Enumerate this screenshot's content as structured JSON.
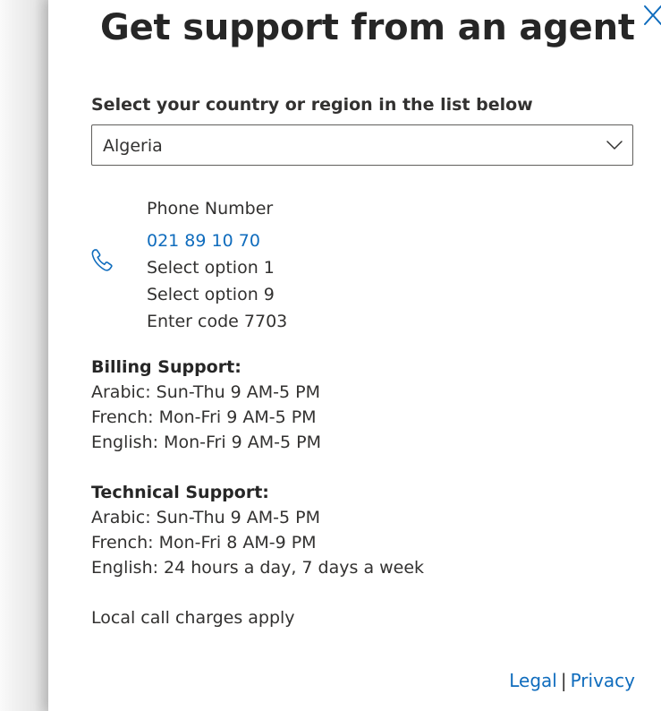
{
  "dialog": {
    "title": "Get support from an agent",
    "close_icon": "close-icon"
  },
  "country": {
    "label": "Select your country or region in the list below",
    "selected": "Algeria",
    "chevron_icon": "chevron-down-icon"
  },
  "phone": {
    "icon": "phone-icon",
    "heading": "Phone Number",
    "number": "021 89 10 70",
    "steps": [
      "Select option 1",
      "Select option 9",
      "Enter code 7703"
    ]
  },
  "billing": {
    "title": "Billing Support:",
    "hours": [
      "Arabic: Sun-Thu 9 AM-5 PM",
      "French: Mon-Fri 9 AM-5 PM",
      "English: Mon-Fri 9 AM-5 PM"
    ]
  },
  "technical": {
    "title": "Technical Support:",
    "hours": [
      "Arabic: Sun-Thu 9 AM-5 PM",
      "French: Mon-Fri 8 AM-9 PM",
      "English: 24 hours a day, 7 days a week"
    ]
  },
  "note": "Local call charges apply",
  "footer": {
    "legal": "Legal",
    "separator": "|",
    "privacy": "Privacy"
  },
  "colors": {
    "link": "#0f6cbd",
    "text": "#323130",
    "heading": "#262626"
  }
}
